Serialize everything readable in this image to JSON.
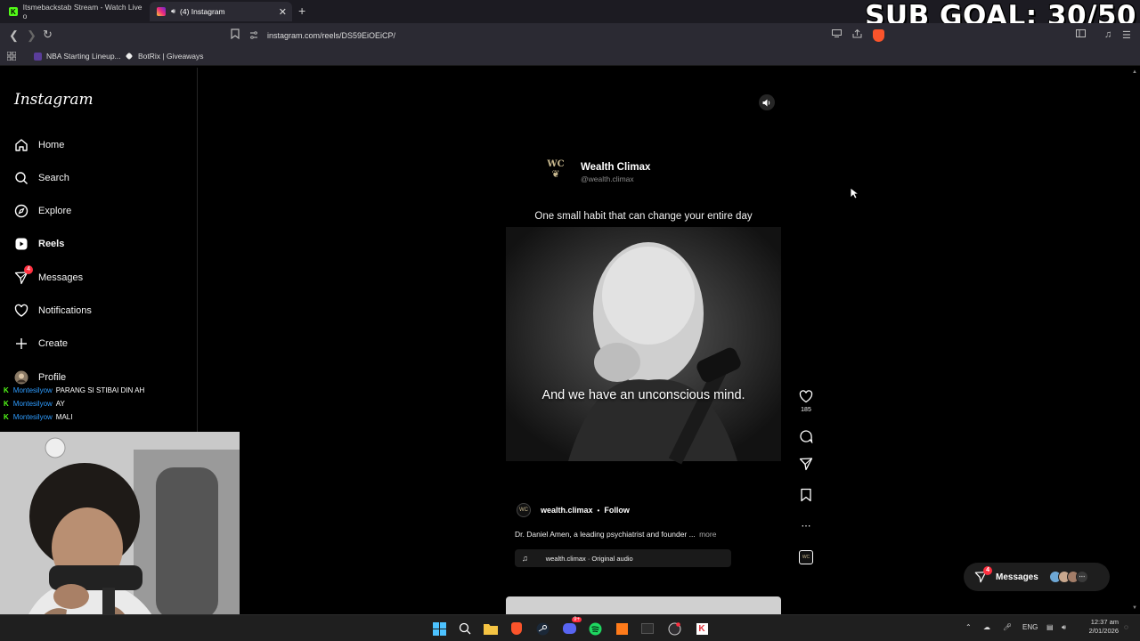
{
  "browser": {
    "tabs": [
      {
        "title": "Itsmebackstab Stream - Watch Live o",
        "active": false
      },
      {
        "title": "(4) Instagram",
        "active": true
      }
    ],
    "url": "instagram.com/reels/DS59EiOEiCP/",
    "bookmarks": [
      "NBA Starting Lineup...",
      "BotRix | Giveaways"
    ]
  },
  "overlay": {
    "sub_goal": "SUB GOAL: 30/50",
    "chat": [
      {
        "user": "Montesilyow",
        "message": "PARANG SI STIBAI DIN AH"
      },
      {
        "user": "Montesilyow",
        "message": "AY"
      },
      {
        "user": "Montesilyow",
        "message": "MALI"
      }
    ]
  },
  "instagram": {
    "logo": "Instagram",
    "nav": [
      {
        "label": "Home",
        "icon": "home-icon"
      },
      {
        "label": "Search",
        "icon": "search-icon"
      },
      {
        "label": "Explore",
        "icon": "compass-icon"
      },
      {
        "label": "Reels",
        "icon": "reels-icon"
      },
      {
        "label": "Messages",
        "icon": "messenger-icon",
        "badge": "4"
      },
      {
        "label": "Notifications",
        "icon": "heart-icon"
      },
      {
        "label": "Create",
        "icon": "plus-icon"
      },
      {
        "label": "Profile",
        "icon": "avatar-icon"
      }
    ],
    "reel": {
      "brand_name": "Wealth Climax",
      "brand_handle": "@wealth.climax",
      "brand_logo_text": "WC",
      "headline": "One small habit that can change your entire day",
      "subtitle": "And we have an unconscious mind.",
      "author": "wealth.climax",
      "follow": "Follow",
      "separator": "•",
      "caption": "Dr. Daniel Amen, a leading psychiatrist and founder ...",
      "more": "more",
      "audio": "wealth.climax · Original audio"
    },
    "actions": {
      "likes": "185"
    },
    "messages_pill": {
      "label": "Messages",
      "badge": "4"
    }
  },
  "taskbar": {
    "language": "ENG",
    "time": "12:37 am",
    "date": "2/01/2026",
    "discord_badge": "9+"
  },
  "colors": {
    "instagram_bg": "#000000",
    "kick_green": "#53fc18",
    "chat_user": "#2e9cff",
    "notification_red": "#ff3040",
    "brave_orange": "#fb542b"
  }
}
